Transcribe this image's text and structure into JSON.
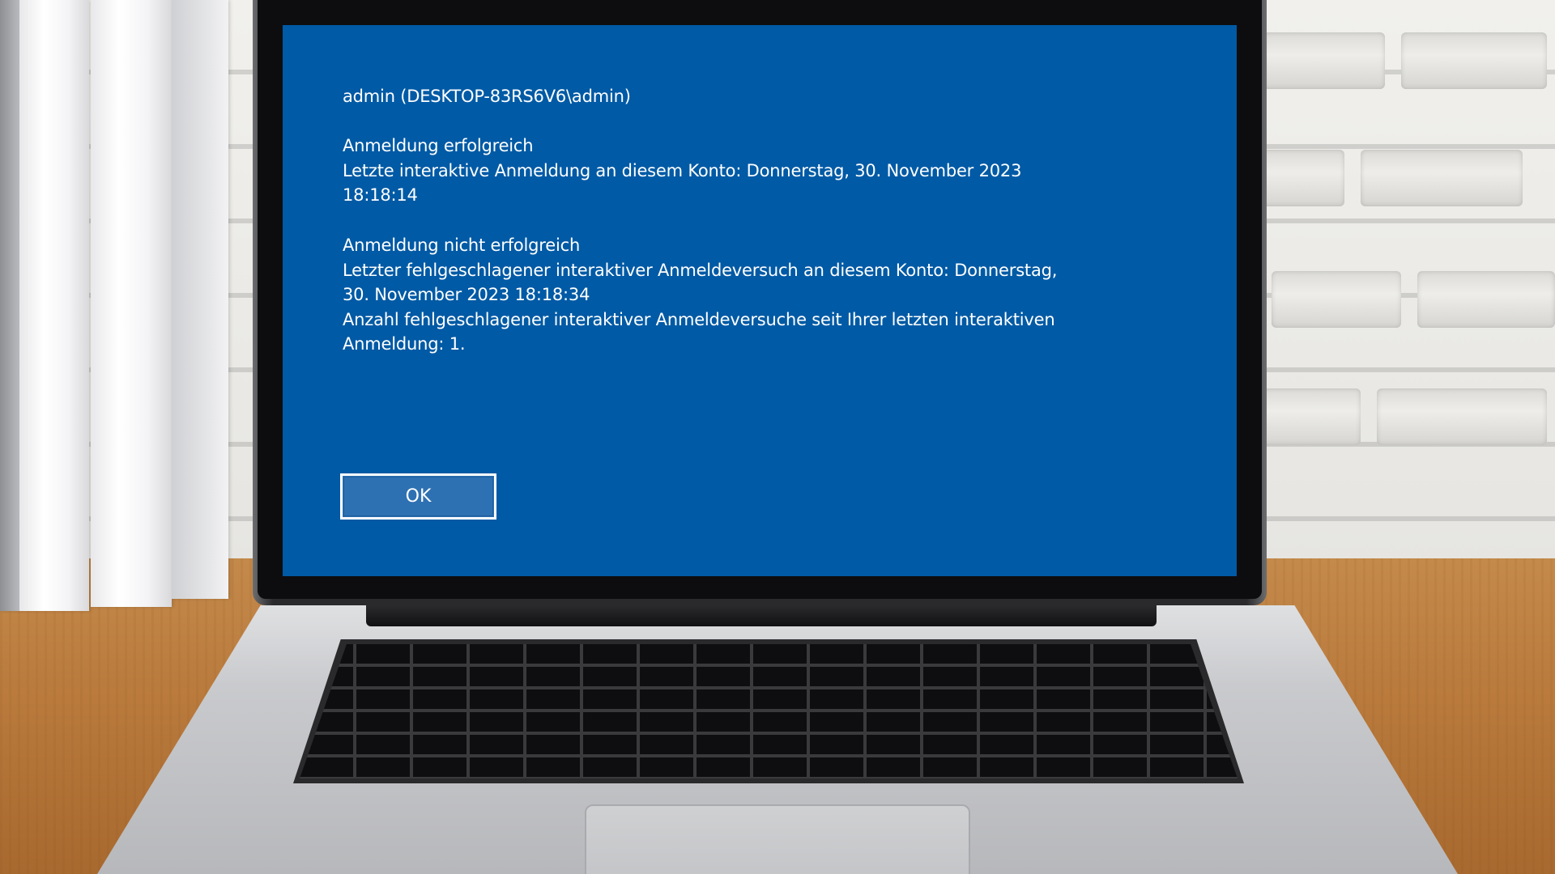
{
  "dialog": {
    "user_line": "admin (DESKTOP-83RS6V6\\admin)",
    "success_heading": "Anmeldung erfolgreich",
    "success_line1": "Letzte interaktive Anmeldung an diesem Konto: Donnerstag, 30. November 2023",
    "success_line2": "18:18:14",
    "failure_heading": "Anmeldung nicht erfolgreich",
    "failure_line1": "Letzter fehlgeschlagener interaktiver Anmeldeversuch an diesem Konto: Donnerstag,",
    "failure_line2": "30. November 2023 18:18:34",
    "failure_line3": "Anzahl fehlgeschlagener interaktiver Anmeldeversuche seit Ihrer letzten interaktiven",
    "failure_line4": "Anmeldung: 1.",
    "ok_label": "OK"
  },
  "colors": {
    "screen_background": "#005aa5",
    "button_fill": "#2e71b3",
    "text": "#ffffff"
  }
}
